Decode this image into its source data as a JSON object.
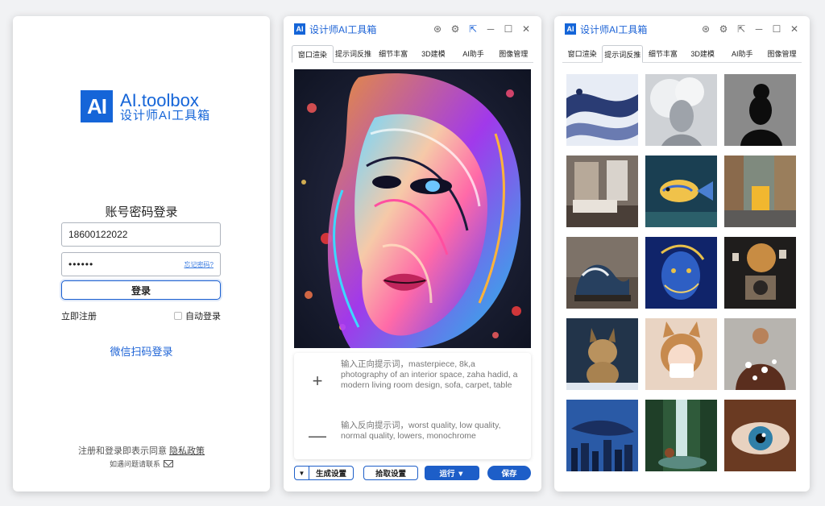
{
  "login": {
    "logo_mark": "AI",
    "brand_en": "AI.toolbox",
    "brand_cn": "设计师AI工具箱",
    "title": "账号密码登录",
    "phone_value": "18600122022",
    "password_mask": "••••••",
    "forgot_label": "忘记密码?",
    "login_button": "登录",
    "register_label": "立即注册",
    "auto_login_label": "自动登录",
    "wechat_label": "微信扫码登录",
    "agree_text": "注册和登录即表示同意",
    "policy_link": "隐私政策",
    "contact_text": "如遇问题请联系"
  },
  "window": {
    "logo_mark": "AI",
    "title": "设计师AI工具箱",
    "tabs": [
      "窗口渲染",
      "提示词反推",
      "细节丰富",
      "3D建模",
      "AI助手",
      "图像管理"
    ]
  },
  "render": {
    "active_tab": 0,
    "positive_icon": "+",
    "positive_prompt": "输入正向提示词，masterpiece, 8k,a photography of an interior space, zaha hadid, a modern living room design, sofa, carpet, table",
    "negative_icon": "—",
    "negative_prompt": "输入反向提示词，worst quality, low quality, normal quality, lowers, monochrome",
    "buttons": {
      "generate_arrow": "▼",
      "generate": "生成设置",
      "pick": "拾取设置",
      "run": "运行 ▼",
      "save": "保存"
    }
  },
  "gallery": {
    "active_tab": 1,
    "thumbnails": [
      "marble-swirl",
      "smoke-woman",
      "silhouette-profile",
      "bedroom-interior",
      "tropical-fish",
      "street-tram",
      "wave-sculpture",
      "blue-gold-face",
      "exploding-camera",
      "lynx",
      "anime-cat-girl",
      "floral-dress-woman",
      "whale-city",
      "waterfall-forest",
      "eye-closeup"
    ]
  }
}
